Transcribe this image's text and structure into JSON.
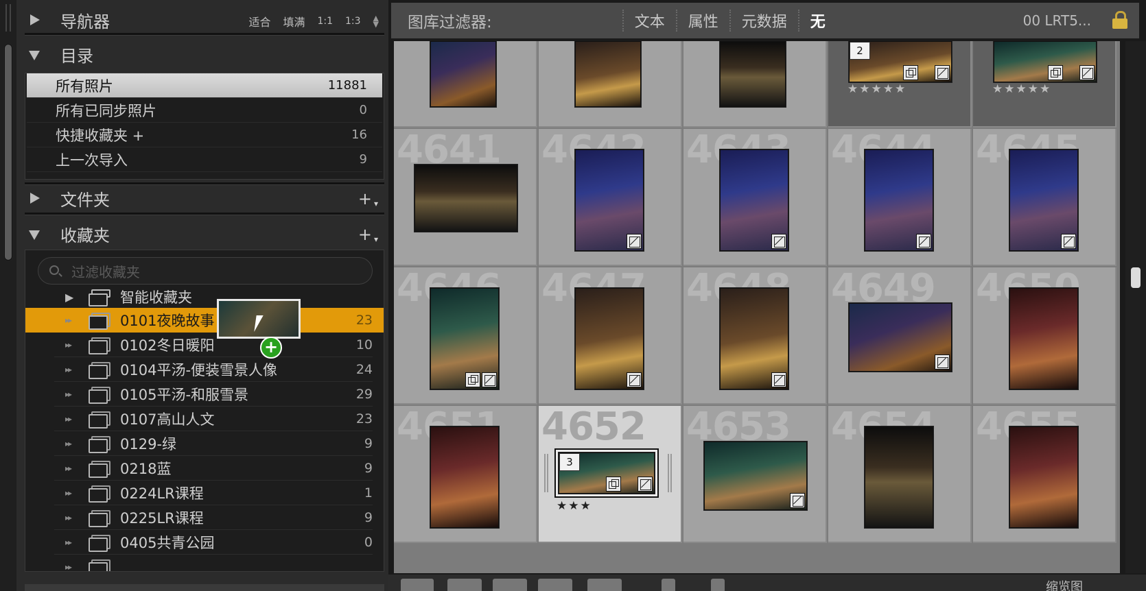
{
  "navigator": {
    "title": "导航器",
    "options": [
      "适合",
      "填满",
      "1:1",
      "1:3"
    ]
  },
  "catalog": {
    "title": "目录",
    "items": [
      {
        "label": "所有照片",
        "count": "11881"
      },
      {
        "label": "所有已同步照片",
        "count": "0"
      },
      {
        "label": "快捷收藏夹 +",
        "count": "16"
      },
      {
        "label": "上一次导入",
        "count": "9"
      }
    ]
  },
  "folders": {
    "title": "文件夹"
  },
  "collections": {
    "title": "收藏夹",
    "search_placeholder": "过滤收藏夹",
    "smart_label": "智能收藏夹",
    "items": [
      {
        "label": "0101夜晚故事",
        "count": "23"
      },
      {
        "label": "0102冬日暖阳",
        "count": "10"
      },
      {
        "label": "0104平汤-便装雪景人像",
        "count": "24"
      },
      {
        "label": "0105平汤-和服雪景",
        "count": "29"
      },
      {
        "label": "0107高山人文",
        "count": "23"
      },
      {
        "label": "0129-绿",
        "count": "9"
      },
      {
        "label": "0218蓝",
        "count": "9"
      },
      {
        "label": "0224LR课程",
        "count": "1"
      },
      {
        "label": "0225LR课程",
        "count": "9"
      },
      {
        "label": "0405共青公园",
        "count": "0"
      }
    ]
  },
  "filter": {
    "title": "图库过滤器:",
    "options": [
      "文本",
      "属性",
      "元数据",
      "无"
    ],
    "preset": "00 LRT5..."
  },
  "grid": {
    "top_stack_1": "2",
    "top_stars": "★★★★★",
    "row2": [
      "4641",
      "4642",
      "4643",
      "4644",
      "4645"
    ],
    "row3": [
      "4646",
      "4647",
      "4648",
      "4649",
      "4650"
    ],
    "row4": [
      "4651",
      "4652",
      "4653",
      "4654",
      "4655"
    ],
    "selected_stack": "3",
    "selected_stars": "★★★"
  },
  "toolbar": {
    "thumbnail_label": "缩览图"
  },
  "colors": {
    "highlight": "#e29a0a",
    "add_badge": "#29a11f"
  }
}
